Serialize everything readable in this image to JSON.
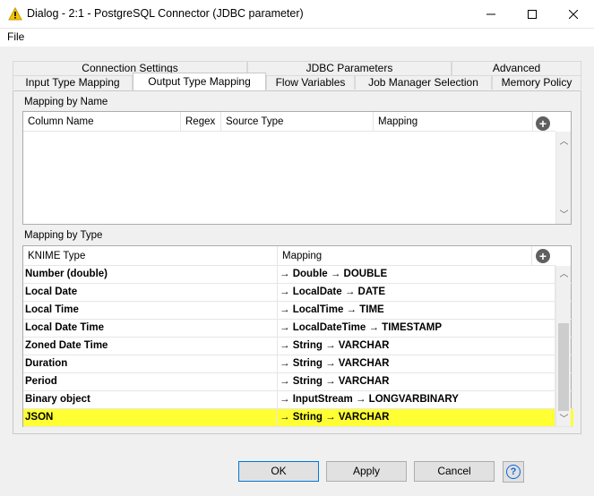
{
  "window": {
    "title": "Dialog - 2:1 - PostgreSQL Connector (JDBC parameter)"
  },
  "menu": {
    "file": "File"
  },
  "tabs": {
    "row_back": [
      "Connection Settings",
      "JDBC Parameters",
      "Advanced"
    ],
    "row_front": [
      "Input Type Mapping",
      "Output Type Mapping",
      "Flow Variables",
      "Job Manager Selection",
      "Memory Policy"
    ],
    "active": "Output Type Mapping"
  },
  "mapping_by_name": {
    "label": "Mapping by Name",
    "columns": [
      "Column Name",
      "Regex",
      "Source Type",
      "Mapping"
    ],
    "rows": []
  },
  "mapping_by_type": {
    "label": "Mapping by Type",
    "columns": [
      "KNIME Type",
      "Mapping"
    ],
    "rows": [
      {
        "type": "Number (double)",
        "mapping": "→ Double → DOUBLE"
      },
      {
        "type": "Local Date",
        "mapping": "→ LocalDate → DATE"
      },
      {
        "type": "Local Time",
        "mapping": "→ LocalTime → TIME"
      },
      {
        "type": "Local Date Time",
        "mapping": "→ LocalDateTime → TIMESTAMP"
      },
      {
        "type": "Zoned Date Time",
        "mapping": "→ String → VARCHAR"
      },
      {
        "type": "Duration",
        "mapping": "→ String → VARCHAR"
      },
      {
        "type": "Period",
        "mapping": "→ String → VARCHAR"
      },
      {
        "type": "Binary object",
        "mapping": "→ InputStream → LONGVARBINARY"
      },
      {
        "type": "JSON",
        "mapping": "→ String → VARCHAR",
        "highlighted": true
      }
    ]
  },
  "buttons": {
    "ok": "OK",
    "apply": "Apply",
    "cancel": "Cancel",
    "help": "?"
  },
  "colors": {
    "highlight": "#ffff33",
    "accent": "#0078d7"
  }
}
